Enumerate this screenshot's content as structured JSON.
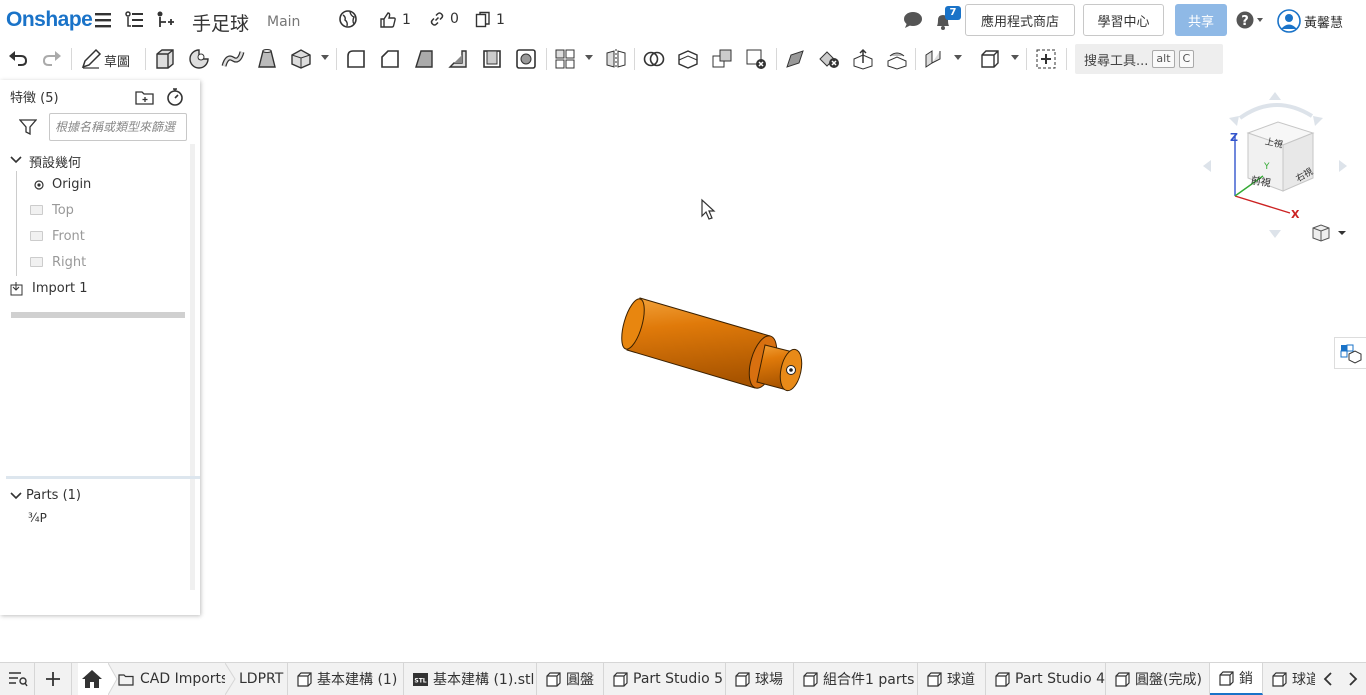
{
  "app": {
    "logo": "Onshape",
    "document_title": "手足球",
    "branch": "Main",
    "likes": "1",
    "links": "0",
    "copies": "1",
    "notifications": "7",
    "app_store_label": "應用程式商店",
    "learning_center_label": "學習中心",
    "share_label": "共享",
    "user_name": "黃馨慧"
  },
  "toolbar": {
    "sketch_label": "草圖",
    "search_label": "搜尋工具...",
    "search_keys": [
      "alt",
      "C"
    ]
  },
  "feature_panel": {
    "title": "特徵 (5)",
    "filter_placeholder": "根據名稱或類型來篩選",
    "default_geometry_label": "預設幾何",
    "origin": "Origin",
    "planes": [
      "Top",
      "Front",
      "Right"
    ],
    "import_label": "Import 1",
    "parts_header": "Parts (1)",
    "part_name": "¾P"
  },
  "view_cube": {
    "top": "上視",
    "front": "前視",
    "right": "右視",
    "axis_x": "X",
    "axis_y": "Y",
    "axis_z": "Z"
  },
  "tabs": {
    "folder": "CAD Imports",
    "items": [
      {
        "label": "LDPRT",
        "icon": "none"
      },
      {
        "label": "基本建構 (1)",
        "icon": "part-studio-icon"
      },
      {
        "label": "基本建構 (1).stl",
        "icon": "stl-icon"
      },
      {
        "label": "圓盤",
        "icon": "part-studio-icon"
      },
      {
        "label": "Part Studio 5",
        "icon": "part-studio-icon"
      },
      {
        "label": "球場",
        "icon": "part-studio-icon"
      },
      {
        "label": "組合件1 parts",
        "icon": "part-studio-icon"
      },
      {
        "label": "球道",
        "icon": "part-studio-icon"
      },
      {
        "label": "Part Studio 4",
        "icon": "part-studio-icon"
      },
      {
        "label": "圓盤(完成)",
        "icon": "part-studio-icon"
      },
      {
        "label": "銷",
        "icon": "part-studio-icon"
      },
      {
        "label": "球道",
        "icon": "part-studio-icon"
      }
    ]
  },
  "colors": {
    "brand": "#1a73c8",
    "part": "#e07a0a",
    "share": "#8fb9e6"
  }
}
